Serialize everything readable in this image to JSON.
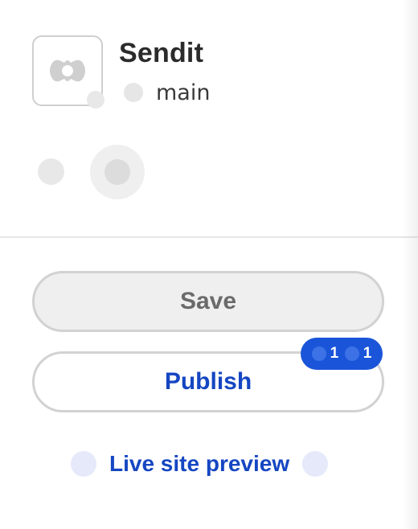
{
  "site": {
    "name": "Sendit",
    "branch": "main",
    "logo_icon": "puzzle-piece-icon",
    "branch_icon": "branch-icon"
  },
  "actions": {
    "save_label": "Save",
    "publish_label": "Publish",
    "change_counts": [
      "1",
      "1"
    ],
    "preview_label": "Live site preview",
    "preview_icon_left": "eye-icon",
    "preview_icon_right": "external-link-icon"
  },
  "colors": {
    "accent": "#1546c2",
    "badge": "#1a55d9",
    "save_bg": "#efefef"
  }
}
